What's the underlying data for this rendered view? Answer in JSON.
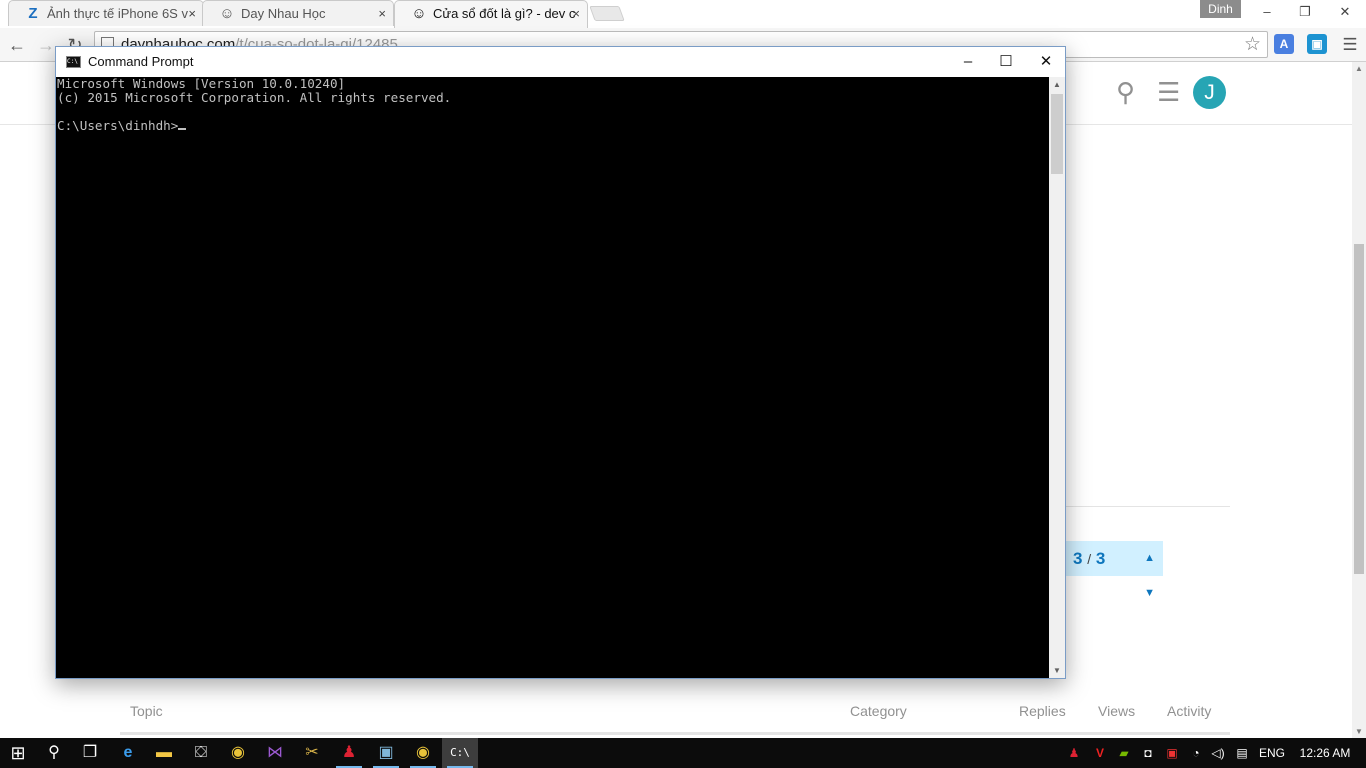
{
  "browser": {
    "tabs": [
      {
        "title": "Ảnh thực tế iPhone 6S v",
        "favicon": "z-logo-icon",
        "close": "×"
      },
      {
        "title": "Day Nhau Học",
        "favicon": "site-face-icon",
        "close": "×"
      },
      {
        "title": "Cửa sổ đốt là gì? - dev c",
        "favicon": "site-face-icon",
        "close": "×",
        "active": true
      }
    ],
    "profile_name": "Dinh",
    "window_controls": {
      "minimize": "–",
      "restore": "❐",
      "close": "✕"
    },
    "url_host": "daynhauhoc.com",
    "url_path": "/t/cua-so-dot-la-gi/12485"
  },
  "page": {
    "avatar_letter": "J",
    "progress": {
      "current": "3",
      "separator": "/",
      "total": "3"
    },
    "topic_columns": [
      "Topic",
      "Category",
      "Replies",
      "Views",
      "Activity"
    ]
  },
  "cmd": {
    "title": "Command Prompt",
    "lines": [
      "Microsoft Windows [Version 10.0.10240]",
      "(c) 2015 Microsoft Corporation. All rights reserved.",
      "",
      "C:\\Users\\dinhdh>"
    ]
  },
  "taskbar": {
    "language": "ENG",
    "time": "12:26 AM"
  },
  "colors": {
    "accent": "#0e76bd",
    "avatar": "#27a5b4",
    "progress_bg": "#d1f0ff",
    "taskbar": "#0c0c0c",
    "console_bg": "#000000",
    "console_fg": "#c0c0c0"
  }
}
